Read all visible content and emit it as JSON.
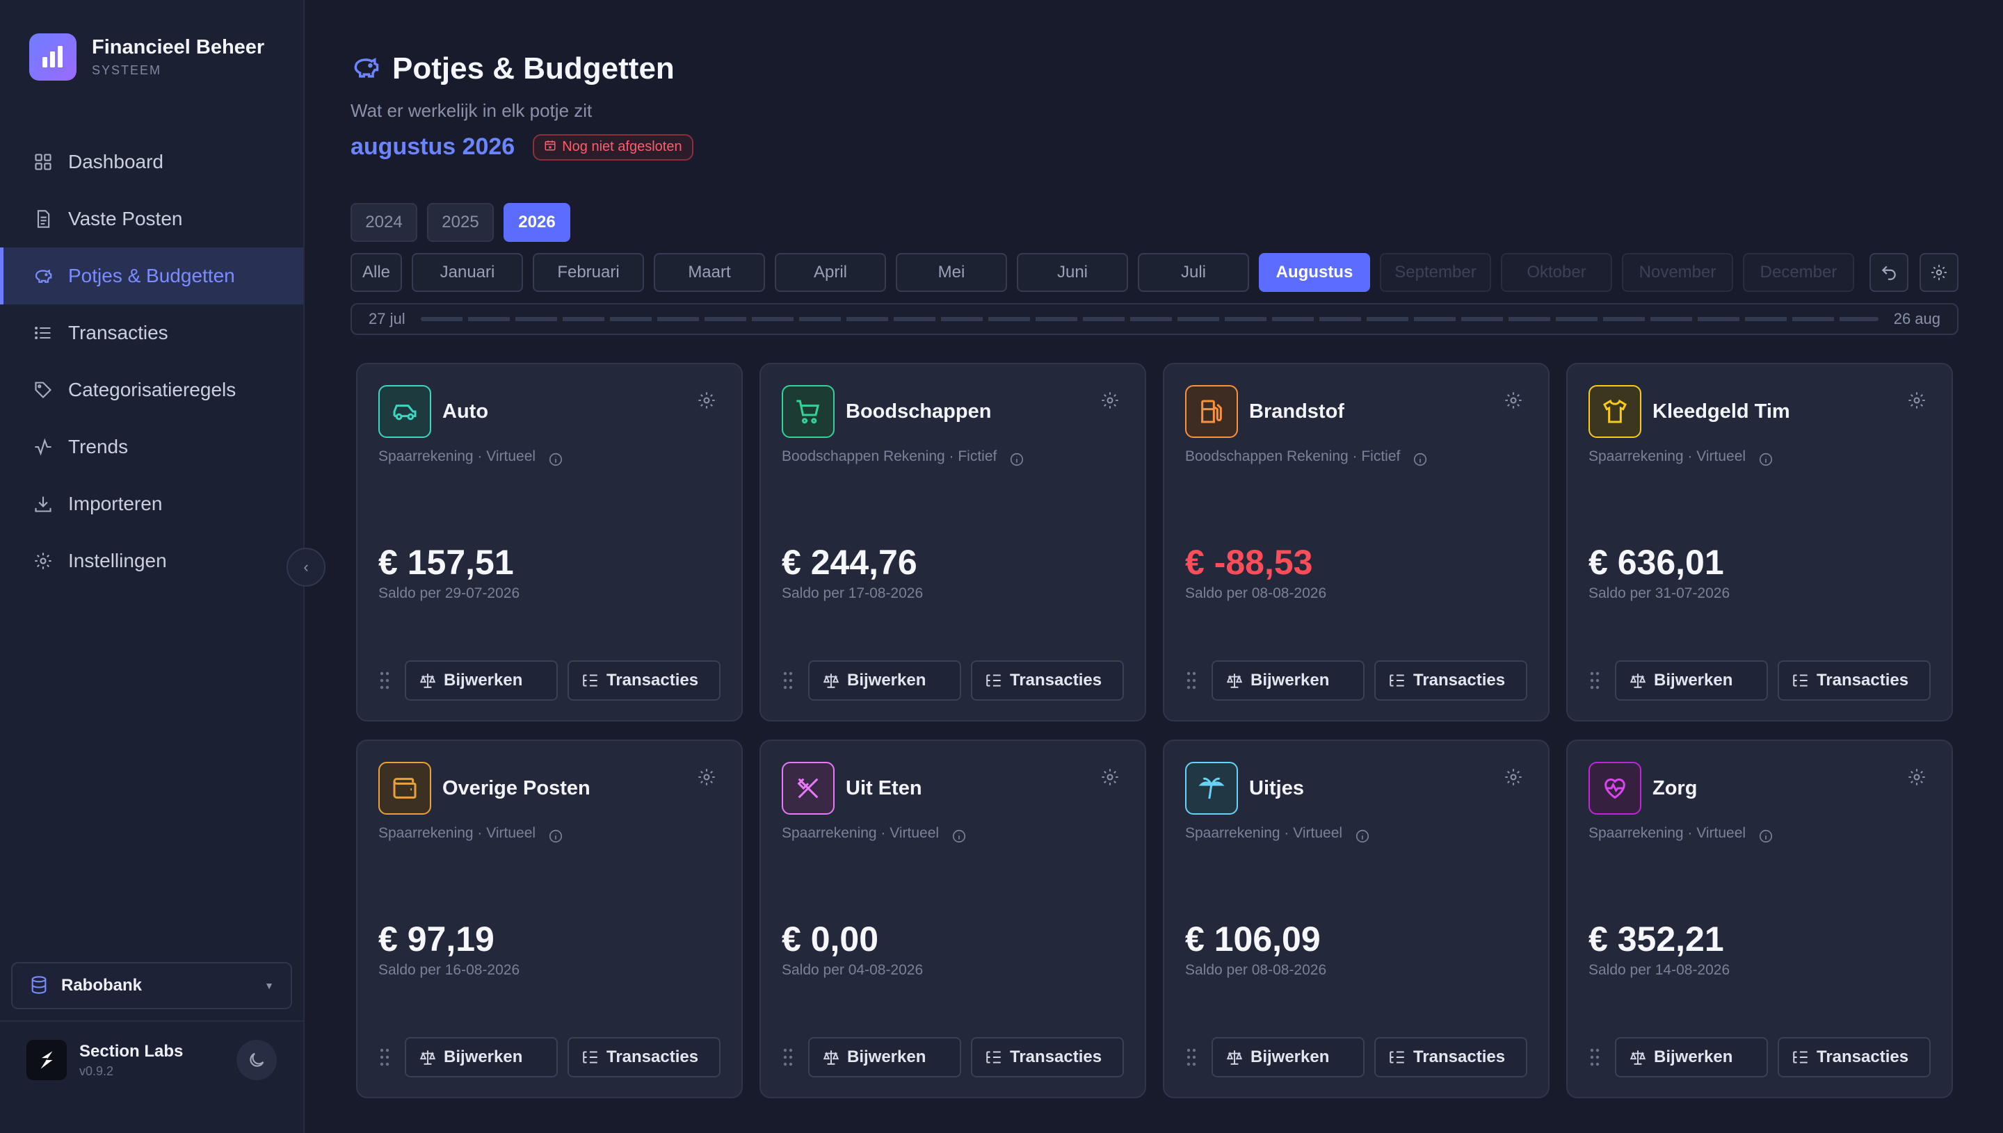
{
  "app": {
    "title": "Financieel Beheer",
    "subtitle": "SYSTEEM"
  },
  "nav": [
    {
      "label": "Dashboard",
      "icon": "grid-icon",
      "active": false
    },
    {
      "label": "Vaste Posten",
      "icon": "document-icon",
      "active": false
    },
    {
      "label": "Potjes & Budgetten",
      "icon": "piggy-bank-icon",
      "active": true
    },
    {
      "label": "Transacties",
      "icon": "list-icon",
      "active": false
    },
    {
      "label": "Categorisatieregels",
      "icon": "tag-icon",
      "active": false
    },
    {
      "label": "Trends",
      "icon": "activity-icon",
      "active": false
    },
    {
      "label": "Importeren",
      "icon": "download-icon",
      "active": false
    },
    {
      "label": "Instellingen",
      "icon": "gear-icon",
      "active": false
    }
  ],
  "bank": {
    "selected": "Rabobank"
  },
  "footer": {
    "name": "Section Labs",
    "version": "v0.9.2"
  },
  "header": {
    "title": "Potjes & Budgetten",
    "subtitle": "Wat er werkelijk in elk potje zit",
    "month": "augustus 2026",
    "status": "Nog niet afgesloten"
  },
  "years": [
    {
      "label": "2024",
      "active": false
    },
    {
      "label": "2025",
      "active": false
    },
    {
      "label": "2026",
      "active": true
    }
  ],
  "months": [
    {
      "label": "Alle",
      "state": "all"
    },
    {
      "label": "Januari",
      "state": "normal"
    },
    {
      "label": "Februari",
      "state": "normal"
    },
    {
      "label": "Maart",
      "state": "normal"
    },
    {
      "label": "April",
      "state": "normal"
    },
    {
      "label": "Mei",
      "state": "normal"
    },
    {
      "label": "Juni",
      "state": "normal"
    },
    {
      "label": "Juli",
      "state": "normal"
    },
    {
      "label": "Augustus",
      "state": "active"
    },
    {
      "label": "September",
      "state": "disabled"
    },
    {
      "label": "Oktober",
      "state": "disabled"
    },
    {
      "label": "November",
      "state": "disabled"
    },
    {
      "label": "December",
      "state": "disabled"
    }
  ],
  "range": {
    "start": "27 jul",
    "end": "26 aug"
  },
  "buttons": {
    "update": "Bijwerken",
    "transactions": "Transacties"
  },
  "pots": [
    {
      "name": "Auto",
      "meta": "Spaarrekening · Virtueel",
      "amount": "€ 157,51",
      "date": "Saldo per 29-07-2026",
      "negative": false,
      "icon": "car-icon",
      "color": "#3fd6c0"
    },
    {
      "name": "Boodschappen",
      "meta": "Boodschappen Rekening · Fictief",
      "amount": "€ 244,76",
      "date": "Saldo per 17-08-2026",
      "negative": false,
      "icon": "cart-icon",
      "color": "#34d399"
    },
    {
      "name": "Brandstof",
      "meta": "Boodschappen Rekening · Fictief",
      "amount": "€ -88,53",
      "date": "Saldo per 08-08-2026",
      "negative": true,
      "icon": "fuel-icon",
      "color": "#fb923c"
    },
    {
      "name": "Kleedgeld Tim",
      "meta": "Spaarrekening · Virtueel",
      "amount": "€ 636,01",
      "date": "Saldo per 31-07-2026",
      "negative": false,
      "icon": "shirt-icon",
      "color": "#facc15"
    },
    {
      "name": "Overige Posten",
      "meta": "Spaarrekening · Virtueel",
      "amount": "€ 97,19",
      "date": "Saldo per 16-08-2026",
      "negative": false,
      "icon": "wallet-icon",
      "color": "#e8a23a"
    },
    {
      "name": "Uit Eten",
      "meta": "Spaarrekening · Virtueel",
      "amount": "€ 0,00",
      "date": "Saldo per 04-08-2026",
      "negative": false,
      "icon": "utensils-icon",
      "color": "#e879f9"
    },
    {
      "name": "Uitjes",
      "meta": "Spaarrekening · Virtueel",
      "amount": "€ 106,09",
      "date": "Saldo per 08-08-2026",
      "negative": false,
      "icon": "palm-tree-icon",
      "color": "#67d4f5"
    },
    {
      "name": "Zorg",
      "meta": "Spaarrekening · Virtueel",
      "amount": "€ 352,21",
      "date": "Saldo per 14-08-2026",
      "negative": false,
      "icon": "heart-pulse-icon",
      "color": "#c026d3"
    }
  ]
}
